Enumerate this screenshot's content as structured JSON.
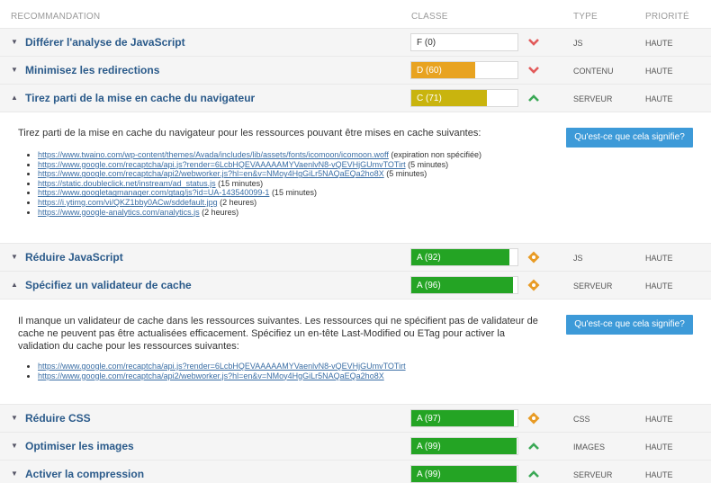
{
  "header": {
    "recommendation": "RECOMMANDATION",
    "classe": "CLASSE",
    "type": "TYPE",
    "priorite": "PRIORITÉ"
  },
  "rows": [
    {
      "name": "Différer l'analyse de JavaScript",
      "grade": "F (0)",
      "score": 0,
      "type": "JS",
      "priority": "HAUTE"
    },
    {
      "name": "Minimisez les redirections",
      "grade": "D (60)",
      "score": 60,
      "type": "CONTENU",
      "priority": "HAUTE"
    },
    {
      "name": "Tirez parti de la mise en cache du navigateur",
      "grade": "C (71)",
      "score": 71,
      "type": "SERVEUR",
      "priority": "HAUTE"
    },
    {
      "name": "Réduire JavaScript",
      "grade": "A (92)",
      "score": 92,
      "type": "JS",
      "priority": "HAUTE"
    },
    {
      "name": "Spécifiez un validateur de cache",
      "grade": "A (96)",
      "score": 96,
      "type": "SERVEUR",
      "priority": "HAUTE"
    },
    {
      "name": "Réduire CSS",
      "grade": "A (97)",
      "score": 97,
      "type": "CSS",
      "priority": "HAUTE"
    },
    {
      "name": "Optimiser les images",
      "grade": "A (99)",
      "score": 99,
      "type": "IMAGES",
      "priority": "HAUTE"
    },
    {
      "name": "Activer la compression",
      "grade": "A (99)",
      "score": 99,
      "type": "SERVEUR",
      "priority": "HAUTE"
    }
  ],
  "details": {
    "cache": {
      "description": "Tirez parti de la mise en cache du navigateur pour les ressources pouvant être mises en cache suivantes:",
      "button": "Qu'est-ce que cela signifie?",
      "items": [
        {
          "url": "https://www.twaino.com/wp-content/themes/Avada/includes/lib/assets/fonts/icomoon/icomoon.woff",
          "note": "(expiration non spécifiée)"
        },
        {
          "url": "https://www.google.com/recaptcha/api.js?render=6LcbHQEVAAAAAMYVaenlvN8-vQEVHjGUmvTOTirt",
          "note": "(5 minutes)"
        },
        {
          "url": "https://www.google.com/recaptcha/api2/webworker.js?hl=en&v=NMoy4HgGiLr5NAQaEQa2ho8X",
          "note": "(5 minutes)"
        },
        {
          "url": "https://static.doubleclick.net/instream/ad_status.js",
          "note": "(15 minutes)"
        },
        {
          "url": "https://www.googletagmanager.com/gtag/js?id=UA-143540099-1",
          "note": "(15 minutes)"
        },
        {
          "url": "https://i.ytimg.com/vi/QKZ1bby0ACw/sddefault.jpg",
          "note": "(2 heures)"
        },
        {
          "url": "https://www.google-analytics.com/analytics.js",
          "note": "(2 heures)"
        }
      ]
    },
    "validator": {
      "description_lines": [
        "Il manque un validateur de cache dans les ressources suivantes. Les ressources qui ne spécifient pas de validateur de",
        "cache ne peuvent pas être actualisées efficacement. Spécifiez un en-tête Last-Modified ou ETag pour activer la",
        "validation du cache pour les ressources suivantes:"
      ],
      "button": "Qu'est-ce que cela signifie?",
      "items": [
        {
          "url": "https://www.google.com/recaptcha/api.js?render=6LcbHQEVAAAAAMYVaenlvN8-vQEVHjGUmvTOTirt"
        },
        {
          "url": "https://www.google.com/recaptcha/api2/webworker.js?hl=en&v=NMoy4HgGiLr5NAQaEQa2ho8X"
        }
      ]
    }
  },
  "colors": {
    "grade_F": "#ffffff",
    "grade_D": "#e8a321",
    "grade_C": "#c9b40e",
    "grade_A": "#24a424",
    "bad": "#e25a5a",
    "good": "#3ba856",
    "warn": "#e89b25",
    "link": "#3a6ea5",
    "button": "#3d9ad8"
  }
}
